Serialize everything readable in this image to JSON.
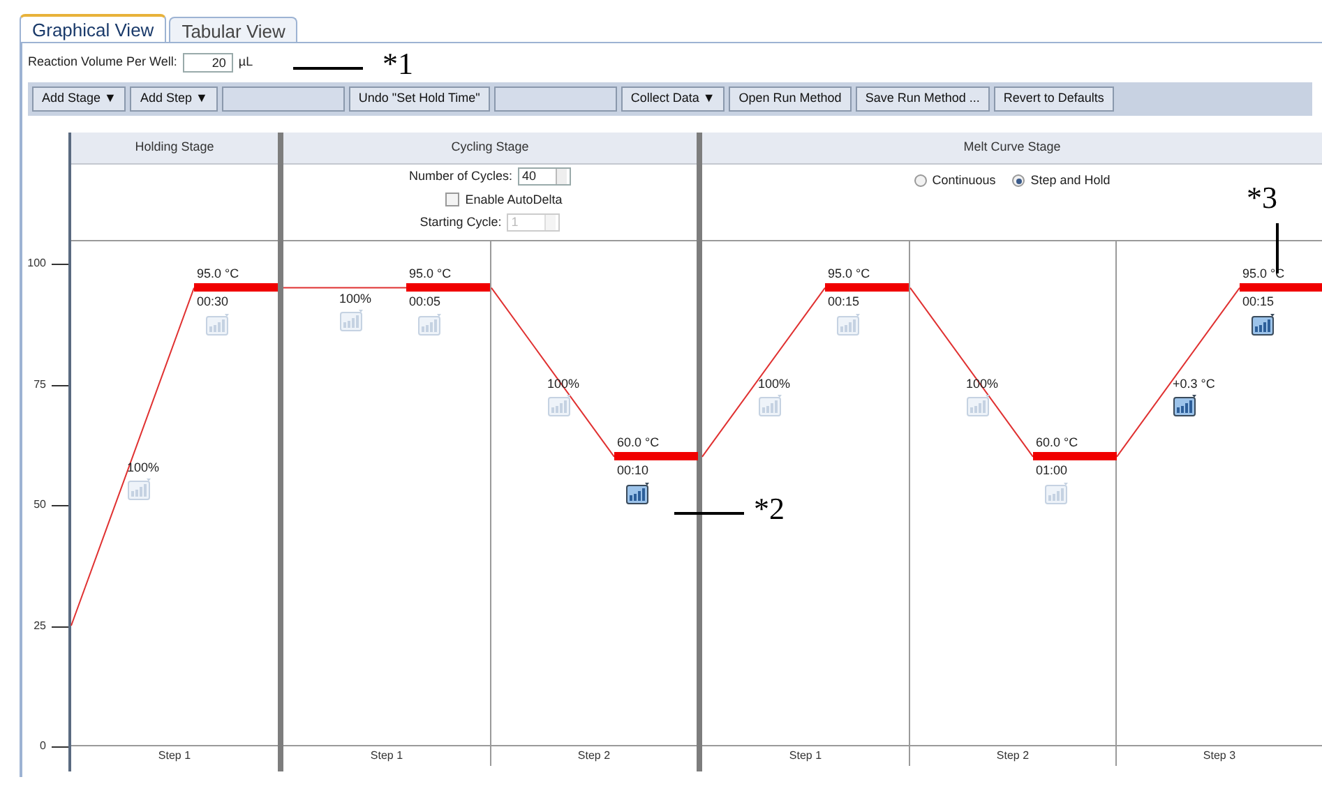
{
  "tabs": [
    {
      "label": "Graphical View",
      "selected": true
    },
    {
      "label": "Tabular View",
      "selected": false
    }
  ],
  "reaction_volume": {
    "label": "Reaction Volume Per Well:",
    "value": "20",
    "unit": "µL"
  },
  "toolbar": [
    {
      "label": "Add Stage ▼",
      "disabled": false
    },
    {
      "label": "Add Step ▼",
      "disabled": false
    },
    {
      "disabled": true
    },
    {
      "label": "Undo \"Set Hold Time\"",
      "disabled": false
    },
    {
      "disabled": true
    },
    {
      "label": "Collect Data ▼",
      "disabled": false
    },
    {
      "label": "Open Run Method",
      "disabled": false
    },
    {
      "label": "Save Run Method ...",
      "disabled": false
    },
    {
      "label": "Revert to Defaults",
      "disabled": false
    }
  ],
  "y_axis": [
    "100",
    "75",
    "50",
    "25",
    "0"
  ],
  "stages": [
    {
      "title": "Holding Stage",
      "kind": "holding",
      "steps": [
        {
          "label": "Step 1",
          "temperature": "95.0 °C",
          "time": "00:30",
          "level": 0.95,
          "ramp": "100%",
          "ramp_collect": false,
          "hold_collect": false
        }
      ]
    },
    {
      "title": "Cycling Stage",
      "kind": "cycling",
      "cycles_label": "Number of Cycles:",
      "cycles": "40",
      "autodelta_label": "Enable AutoDelta",
      "autodelta": false,
      "starting_cycle_label": "Starting Cycle:",
      "starting_cycle": "1",
      "steps": [
        {
          "label": "Step 1",
          "temperature": "95.0 °C",
          "time": "00:05",
          "level": 0.95,
          "ramp": "100%",
          "ramp_collect": false,
          "hold_collect": false
        },
        {
          "label": "Step 2",
          "temperature": "60.0 °C",
          "time": "00:10",
          "level": 0.6,
          "ramp": "100%",
          "ramp_collect": false,
          "hold_collect": true
        }
      ]
    },
    {
      "title": "Melt Curve Stage",
      "kind": "melt",
      "modes": [
        {
          "label": "Continuous",
          "selected": false
        },
        {
          "label": "Step and Hold",
          "selected": true
        }
      ],
      "steps": [
        {
          "label": "Step 1",
          "temperature": "95.0 °C",
          "time": "00:15",
          "level": 0.95,
          "ramp": "100%",
          "ramp_collect": false,
          "hold_collect": false
        },
        {
          "label": "Step 2",
          "temperature": "60.0 °C",
          "time": "01:00",
          "level": 0.6,
          "ramp": "100%",
          "ramp_collect": false,
          "hold_collect": false
        },
        {
          "label": "Step 3",
          "temperature": "95.0 °C",
          "time": "00:15",
          "level": 0.95,
          "ramp": "+0.3 °C",
          "ramp_collect": true,
          "hold_collect": true
        }
      ]
    }
  ],
  "annotations": [
    "*1",
    "*2",
    "*3"
  ]
}
